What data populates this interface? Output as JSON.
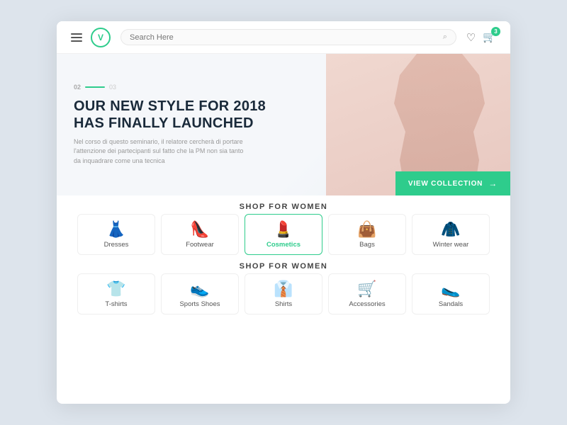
{
  "header": {
    "logo_letter": "V",
    "search_placeholder": "Search Here",
    "cart_count": "3"
  },
  "hero": {
    "slide_current": "02",
    "slide_next": "03",
    "title_line1": "OUR NEW STYLE FOR 2018",
    "title_line2": "HAS FINALLY LAUNCHED",
    "description": "Nel corso di questo seminario, il relatore cercherà di portare l'attenzione dei partecipanti sul fatto che la PM non sia tanto da inquadrare come una tecnica",
    "cta_label": "VIEW COLLECTION"
  },
  "section_women": {
    "title": "SHOP FOR WOMEN",
    "categories": [
      {
        "id": "dresses",
        "label": "Dresses",
        "icon": "👗",
        "active": false
      },
      {
        "id": "footwear",
        "label": "Footwear",
        "icon": "👠",
        "active": false
      },
      {
        "id": "cosmetics",
        "label": "Cosmetics",
        "icon": "💄",
        "active": true
      },
      {
        "id": "bags",
        "label": "Bags",
        "icon": "👜",
        "active": false
      },
      {
        "id": "winter-wear",
        "label": "Winter wear",
        "icon": "🧥",
        "active": false
      }
    ]
  },
  "section_men": {
    "title": "SHOP FOR WOMEN",
    "categories": [
      {
        "id": "tshirts",
        "label": "T-shirts",
        "icon": "👕",
        "active": false
      },
      {
        "id": "sports-shoes",
        "label": "Sports Shoes",
        "icon": "👟",
        "active": false
      },
      {
        "id": "shirts",
        "label": "Shirts",
        "icon": "👔",
        "active": false
      },
      {
        "id": "accessories",
        "label": "Accessories",
        "icon": "🛒",
        "active": false
      },
      {
        "id": "sandals",
        "label": "Sandals",
        "icon": "🥿",
        "active": false
      }
    ]
  }
}
